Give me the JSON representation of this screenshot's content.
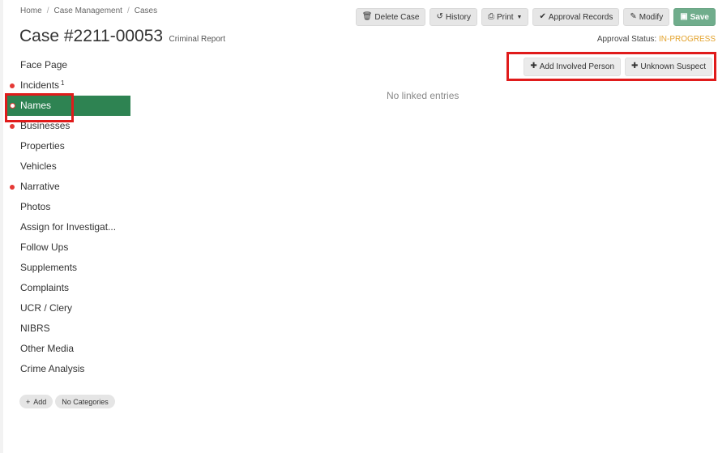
{
  "breadcrumb": [
    "Home",
    "Case Management",
    "Cases"
  ],
  "header": {
    "title": "Case #2211-00053",
    "subtitle": "Criminal Report"
  },
  "toolbar": {
    "delete_label": "Delete Case",
    "history_label": "History",
    "print_label": "Print",
    "approval_records_label": "Approval Records",
    "modify_label": "Modify",
    "save_label": "Save"
  },
  "approval": {
    "label": "Approval Status:",
    "status": "IN-PROGRESS"
  },
  "sidebar": {
    "items": [
      {
        "label": "Face Page",
        "indicator": "none"
      },
      {
        "label": "Incidents",
        "indicator": "dot",
        "count": "1"
      },
      {
        "label": "Names",
        "indicator": "ring",
        "active": true
      },
      {
        "label": "Businesses",
        "indicator": "dot"
      },
      {
        "label": "Properties",
        "indicator": "none"
      },
      {
        "label": "Vehicles",
        "indicator": "none"
      },
      {
        "label": "Narrative",
        "indicator": "dot"
      },
      {
        "label": "Photos",
        "indicator": "none"
      },
      {
        "label": "Assign for Investigat...",
        "indicator": "none"
      },
      {
        "label": "Follow Ups",
        "indicator": "none"
      },
      {
        "label": "Supplements",
        "indicator": "none"
      },
      {
        "label": "Complaints",
        "indicator": "none"
      },
      {
        "label": "UCR / Clery",
        "indicator": "none"
      },
      {
        "label": "NIBRS",
        "indicator": "none"
      },
      {
        "label": "Other Media",
        "indicator": "none"
      },
      {
        "label": "Crime Analysis",
        "indicator": "none"
      }
    ]
  },
  "tags": {
    "add_label": "Add",
    "categories_label": "No Categories"
  },
  "main": {
    "add_involved_label": "Add Involved Person",
    "unknown_suspect_label": "Unknown Suspect",
    "empty_text": "No linked entries"
  },
  "colors": {
    "active_nav": "#2e8352",
    "save_button": "#70ad8c",
    "status_text": "#e3a22b",
    "indicator_dot": "#e53935",
    "highlight_box": "#e01b1b"
  }
}
